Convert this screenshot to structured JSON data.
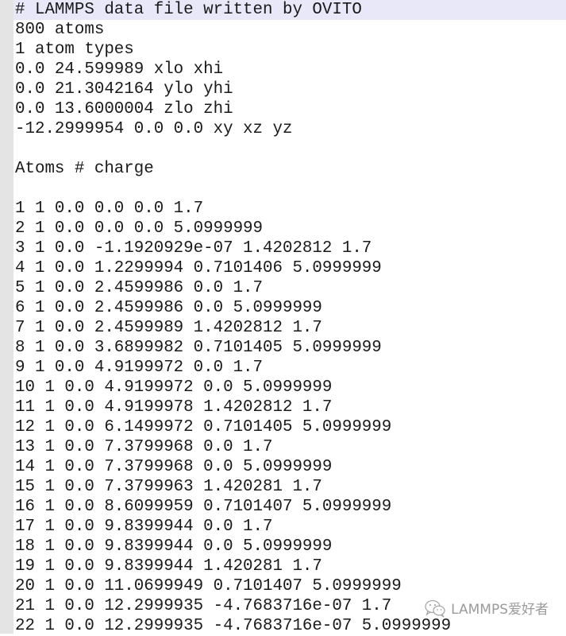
{
  "editor": {
    "lines": [
      "# LAMMPS data file written by OVITO",
      "800 atoms",
      "1 atom types",
      "0.0 24.599989 xlo xhi",
      "0.0 21.3042164 ylo yhi",
      "0.0 13.6000004 zlo zhi",
      "-12.2999954 0.0 0.0 xy xz yz",
      "",
      "Atoms # charge",
      "",
      "1 1 0.0 0.0 0.0 1.7",
      "2 1 0.0 0.0 0.0 5.0999999",
      "3 1 0.0 -1.1920929e-07 1.4202812 1.7",
      "4 1 0.0 1.2299994 0.7101406 5.0999999",
      "5 1 0.0 2.4599986 0.0 1.7",
      "6 1 0.0 2.4599986 0.0 5.0999999",
      "7 1 0.0 2.4599989 1.4202812 1.7",
      "8 1 0.0 3.6899982 0.7101405 5.0999999",
      "9 1 0.0 4.9199972 0.0 1.7",
      "10 1 0.0 4.9199972 0.0 5.0999999",
      "11 1 0.0 4.9199978 1.4202812 1.7",
      "12 1 0.0 6.1499972 0.7101405 5.0999999",
      "13 1 0.0 7.3799968 0.0 1.7",
      "14 1 0.0 7.3799968 0.0 5.0999999",
      "15 1 0.0 7.3799963 1.420281 1.7",
      "16 1 0.0 8.6099959 0.7101407 5.0999999",
      "17 1 0.0 9.8399944 0.0 1.7",
      "18 1 0.0 9.8399944 0.0 5.0999999",
      "19 1 0.0 9.8399944 1.420281 1.7",
      "20 1 0.0 11.0699949 0.7101407 5.0999999",
      "21 1 0.0 12.2999935 -4.7683716e-07 1.7",
      "22 1 0.0 12.2999935 -4.7683716e-07 5.0999999"
    ],
    "current_line_index": 0
  },
  "watermark": {
    "icon": "wechat-icon",
    "text": "LAMMPS爱好者"
  },
  "colors": {
    "gutter": "#e4e4e4",
    "current_line_highlight": "#e8e8f8",
    "text": "#1a1a1a"
  }
}
